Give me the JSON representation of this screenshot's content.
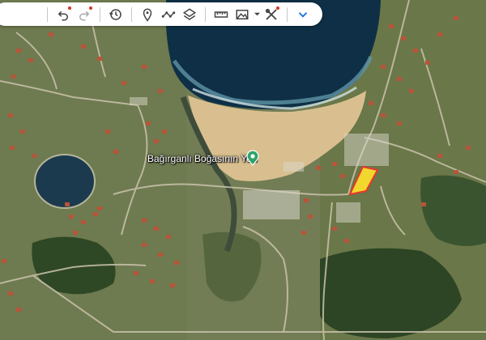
{
  "map": {
    "place_label": "Bağırganlı Boğasının Yeri",
    "parcel_outline_color": "#e8352b",
    "parcel_fill_color": "#f2d72e"
  },
  "toolbar": {
    "accent_color": "#1a73e8",
    "icons": [
      "undo-icon",
      "redo-icon",
      "history-icon",
      "add-marker-icon",
      "draw-line-icon",
      "layers-icon",
      "measure-icon",
      "image-icon",
      "dropdown-caret-icon",
      "tools-icon",
      "collapse-icon"
    ]
  }
}
